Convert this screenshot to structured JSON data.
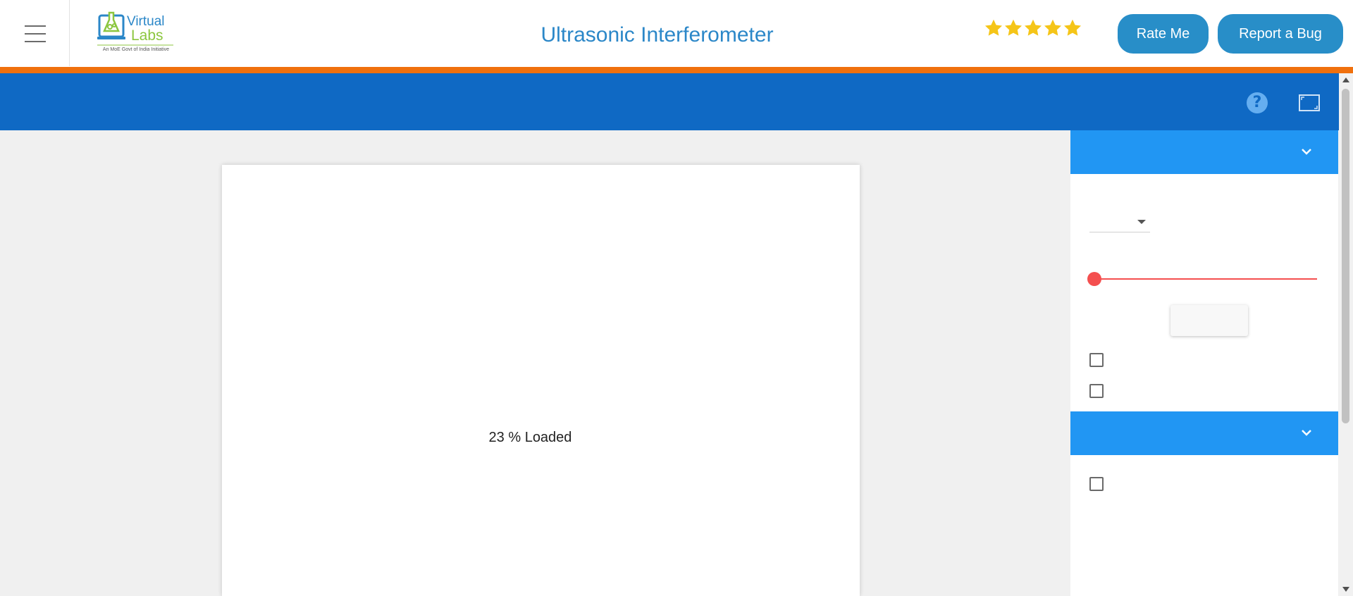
{
  "header": {
    "title": "Ultrasonic Interferometer",
    "logo_name": "Virtual",
    "logo_name2": "Labs",
    "logo_sub": "An MoE Govt of India Initiative",
    "rating_stars": 5,
    "star_color": "#f5c518",
    "accent_bar_color": "#f0700d",
    "rate_label": "Rate Me",
    "bug_label": "Report a Bug",
    "button_color": "#288ec8"
  },
  "toolbar": {
    "color": "#0f69c4",
    "help_icon": "question-circle-icon",
    "help_glyph": "?",
    "fullscreen_icon": "fullscreen-icon"
  },
  "canvas": {
    "loading_text": "23 % Loaded"
  },
  "side_panel": {
    "accordion_color": "#2196f3",
    "slider_color": "#f44f4f",
    "slider_value": 0
  }
}
